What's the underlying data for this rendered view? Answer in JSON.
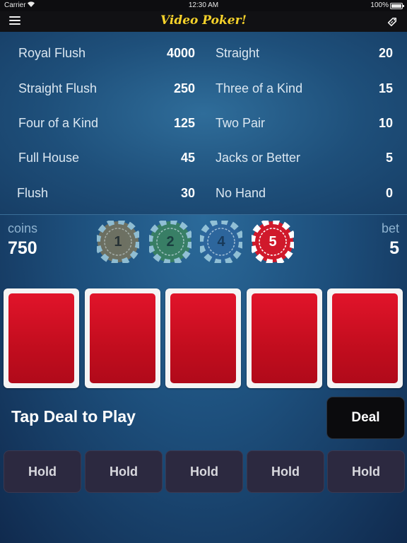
{
  "status_bar": {
    "carrier": "Carrier",
    "time": "12:30 AM",
    "battery": "100%"
  },
  "nav": {
    "title": "Video Poker!",
    "menu_icon": "hamburger-icon",
    "right_icon": "tag-icon"
  },
  "paytable": [
    {
      "name": "Royal Flush",
      "payout": "4000"
    },
    {
      "name": "Straight Flush",
      "payout": "250"
    },
    {
      "name": "Four of a Kind",
      "payout": "125"
    },
    {
      "name": "Full House",
      "payout": "45"
    },
    {
      "name": "Flush",
      "payout": "30"
    },
    {
      "name": "Straight",
      "payout": "20"
    },
    {
      "name": "Three of a Kind",
      "payout": "15"
    },
    {
      "name": "Two Pair",
      "payout": "10"
    },
    {
      "name": "Jacks or Better",
      "payout": "5"
    },
    {
      "name": "No Hand",
      "payout": "0"
    }
  ],
  "coins": {
    "label": "coins",
    "value": "750"
  },
  "bet": {
    "label": "bet",
    "value": "5"
  },
  "chips": [
    {
      "value": "1",
      "color": "#8a7a55",
      "selected": false
    },
    {
      "value": "2",
      "color": "#3f8a55",
      "selected": false
    },
    {
      "value": "4",
      "color": "#2f66a0",
      "selected": false
    },
    {
      "value": "5",
      "color": "#d0192b",
      "selected": true
    }
  ],
  "cards": [
    "card-back",
    "card-back",
    "card-back",
    "card-back",
    "card-back"
  ],
  "prompt": "Tap Deal to Play",
  "deal_label": "Deal",
  "hold_labels": [
    "Hold",
    "Hold",
    "Hold",
    "Hold",
    "Hold"
  ],
  "colors": {
    "title": "#f6d22a",
    "card_back": "#d11224",
    "background": "#1d4f7c"
  }
}
